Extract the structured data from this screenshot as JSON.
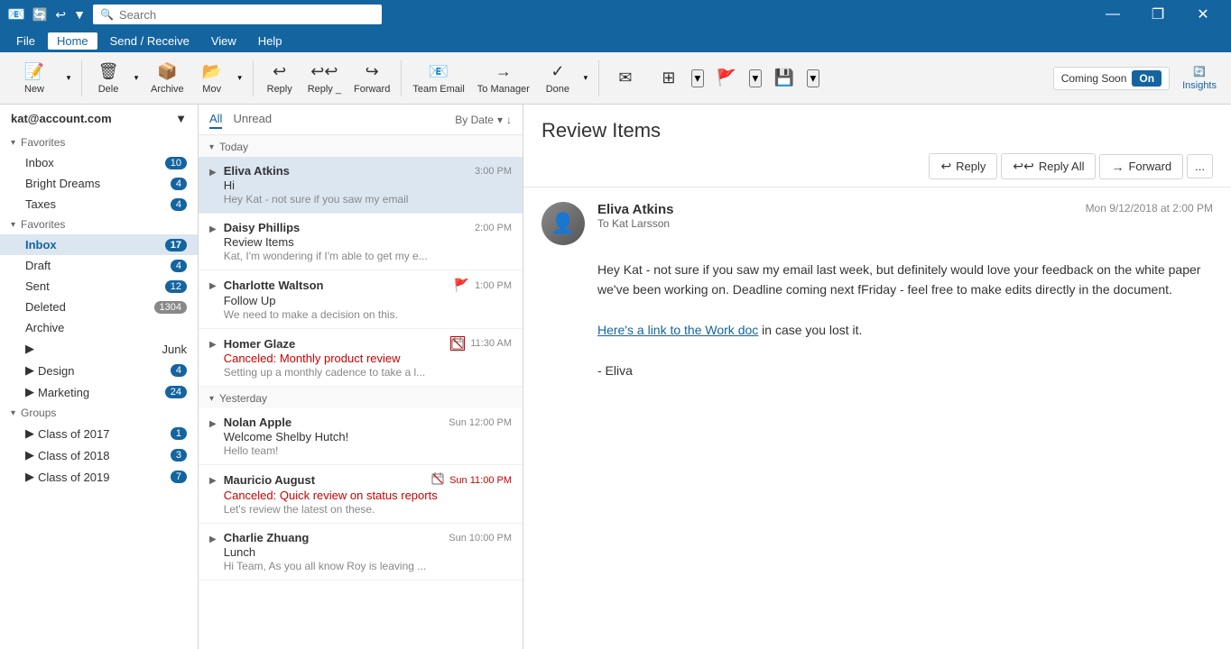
{
  "titlebar": {
    "search_placeholder": "Search",
    "min_label": "—",
    "restore_label": "❐",
    "close_label": "✕"
  },
  "menubar": {
    "items": [
      {
        "id": "file",
        "label": "File",
        "active": false
      },
      {
        "id": "home",
        "label": "Home",
        "active": true
      },
      {
        "id": "send_receive",
        "label": "Send / Receive",
        "active": false
      },
      {
        "id": "view",
        "label": "View",
        "active": false
      },
      {
        "id": "help",
        "label": "Help",
        "active": false
      }
    ]
  },
  "toolbar": {
    "new_label": "New",
    "delete_label": "Dele",
    "archive_label": "Archive",
    "move_label": "Mov",
    "reply_label": "Reply",
    "reply_all_label": "Reply _",
    "forward_label": "Forward",
    "team_email_label": "Team Email",
    "to_manager_label": "To Manager",
    "done_label": "Done",
    "insights_label": "Insights",
    "coming_soon_label": "Coming Soon",
    "toggle_label": "On"
  },
  "sidebar": {
    "account": "kat@account.com",
    "favorites_label": "Favorites",
    "items_favorites": [
      {
        "id": "inbox",
        "label": "Inbox",
        "count": 10,
        "active": false
      },
      {
        "id": "bright_dreams",
        "label": "Bright Dreams",
        "count": 4,
        "active": false
      },
      {
        "id": "taxes",
        "label": "Taxes",
        "count": 4,
        "active": false
      }
    ],
    "favorites2_label": "Favorites",
    "items_main": [
      {
        "id": "inbox2",
        "label": "Inbox",
        "count": 17,
        "active": false
      },
      {
        "id": "draft",
        "label": "Draft",
        "count": 4,
        "active": false
      },
      {
        "id": "sent",
        "label": "Sent",
        "count": 12,
        "active": false
      },
      {
        "id": "deleted",
        "label": "Deleted",
        "count": 1304,
        "active": false
      },
      {
        "id": "archive",
        "label": "Archive",
        "count": null,
        "active": false
      },
      {
        "id": "junk",
        "label": "Junk",
        "count": null,
        "active": false
      }
    ],
    "design_label": "Design",
    "design_count": 4,
    "marketing_label": "Marketing",
    "marketing_count": 24,
    "groups_label": "Groups",
    "groups": [
      {
        "id": "class_2017",
        "label": "Class of 2017",
        "count": 1
      },
      {
        "id": "class_2018",
        "label": "Class of 2018",
        "count": 3
      },
      {
        "id": "class_2019",
        "label": "Class of 2019",
        "count": 7
      }
    ]
  },
  "email_list": {
    "filter_all": "All",
    "filter_unread": "Unread",
    "sort_label": "By Date",
    "today_label": "Today",
    "yesterday_label": "Yesterday",
    "emails_today": [
      {
        "id": 1,
        "sender": "Eliva Atkins",
        "subject": "Hi",
        "preview": "Hey Kat - not sure if you saw my email",
        "time": "3:00 PM",
        "time_red": false,
        "active": true,
        "flag": false,
        "calendar": false
      },
      {
        "id": 2,
        "sender": "Daisy Phillips",
        "subject": "Review Items",
        "preview": "Kat, I'm wondering if I'm able to get my e...",
        "time": "2:00 PM",
        "time_red": false,
        "active": false,
        "flag": false,
        "calendar": false
      },
      {
        "id": 3,
        "sender": "Charlotte Waltson",
        "subject": "Follow Up",
        "preview": "We need to make a decision on this.",
        "time": "1:00 PM",
        "time_red": false,
        "active": false,
        "flag": true,
        "calendar": false
      },
      {
        "id": 4,
        "sender": "Homer Glaze",
        "subject": "Canceled: Monthly product review",
        "preview": "Setting up a monthly cadence to take a l...",
        "time": "11:30 AM",
        "time_red": false,
        "active": false,
        "flag": false,
        "calendar": true,
        "canceled": true
      }
    ],
    "emails_yesterday": [
      {
        "id": 5,
        "sender": "Nolan Apple",
        "subject": "Welcome Shelby Hutch!",
        "preview": "Hello team!",
        "time": "Sun 12:00 PM",
        "time_red": false,
        "active": false,
        "flag": false,
        "calendar": false
      },
      {
        "id": 6,
        "sender": "Mauricio August",
        "subject": "Canceled: Quick review on status reports",
        "preview": "Let's review the latest on these.",
        "time": "Sun 11:00 PM",
        "time_red": true,
        "active": false,
        "flag": false,
        "calendar": true,
        "canceled": true
      },
      {
        "id": 7,
        "sender": "Charlie Zhuang",
        "subject": "Lunch",
        "preview": "Hi Team, As you all know Roy is leaving ...",
        "time": "Sun 10:00 PM",
        "time_red": false,
        "active": false,
        "flag": false,
        "calendar": false
      }
    ]
  },
  "reading_pane": {
    "title": "Review Items",
    "reply_label": "Reply",
    "reply_all_label": "Reply All",
    "forward_label": "Forward",
    "more_label": "...",
    "sender": "Eliva Atkins",
    "to_label": "To",
    "to": "Kat Larsson",
    "date": "Mon 9/12/2018 at 2:00 PM",
    "body_text1": "Hey Kat - not sure if you saw my email last week, but definitely would love your feedback on the white paper we've been working on. Deadline coming next fFriday - feel free to make edits directly in the document.",
    "link_text": "Here's a link to the Work doc",
    "link_suffix": " in case you lost it.",
    "signature": "- Eliva"
  }
}
